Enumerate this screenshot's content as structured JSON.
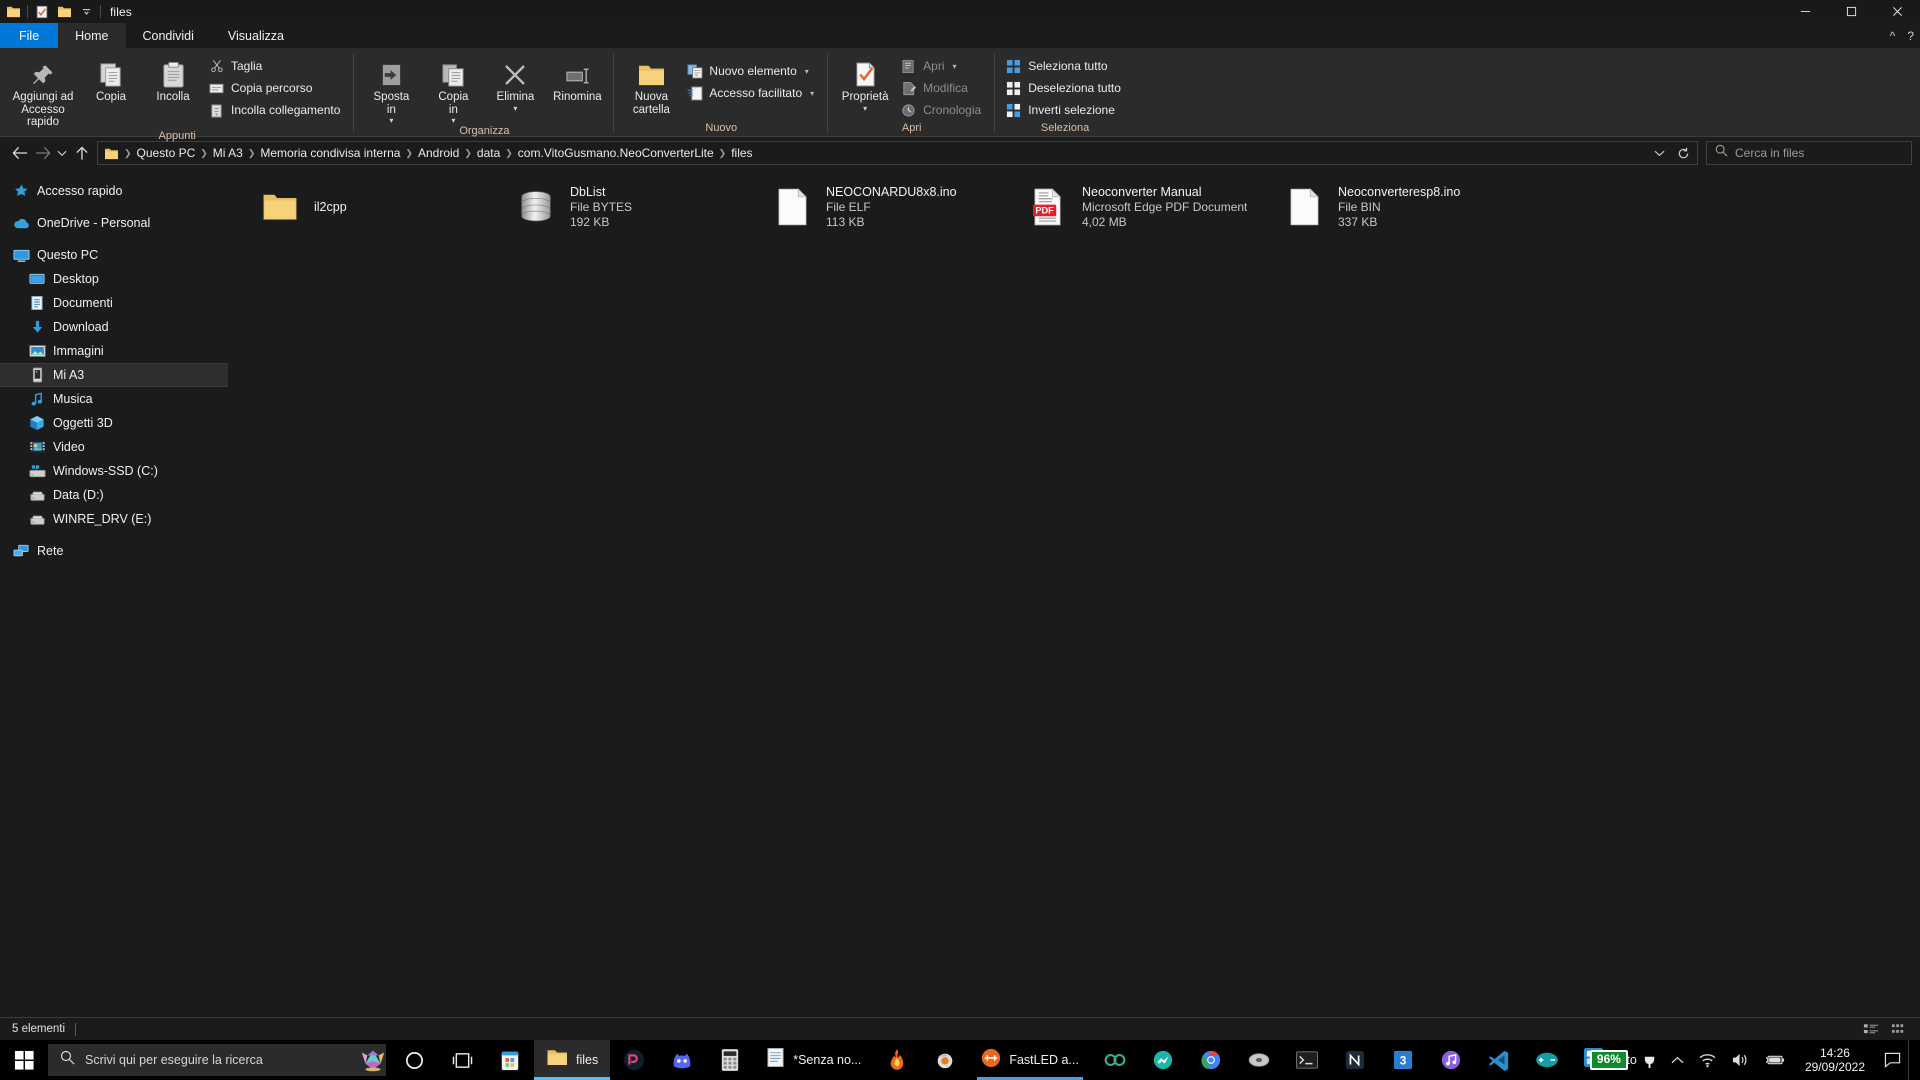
{
  "window": {
    "title": "files",
    "quick_access_icons": [
      "folder-icon",
      "properties-check-icon",
      "new-folder-icon",
      "customize-chevron-icon"
    ],
    "minimize_label": "Riduci a icona",
    "maximize_label": "Ingrandisci",
    "close_label": "Chiudi"
  },
  "tabs": [
    {
      "label": "File",
      "type": "file"
    },
    {
      "label": "Home",
      "type": "active"
    },
    {
      "label": "Condividi",
      "type": "normal"
    },
    {
      "label": "Visualizza",
      "type": "normal"
    }
  ],
  "tab_right": {
    "collapse": "chevron-up-icon",
    "help": "help-icon"
  },
  "ribbon": {
    "groups": [
      {
        "label": "Appunti",
        "big": [
          {
            "label": "Aggiungi ad\nAccesso rapido",
            "icon": "pin-icon",
            "wide": true
          },
          {
            "label": "Copia",
            "icon": "copy-icon"
          },
          {
            "label": "Incolla",
            "icon": "paste-icon"
          }
        ],
        "small": [
          {
            "label": "Taglia",
            "icon": "scissors-icon",
            "dim": false
          },
          {
            "label": "Copia percorso",
            "icon": "copy-path-icon",
            "dim": false
          },
          {
            "label": "Incolla collegamento",
            "icon": "paste-shortcut-icon",
            "dim": false
          }
        ]
      },
      {
        "label": "Organizza",
        "big": [
          {
            "label": "Sposta\nin",
            "icon": "move-to-icon",
            "caret": true
          },
          {
            "label": "Copia\nin",
            "icon": "copy-to-icon",
            "caret": true
          },
          {
            "label": "Elimina",
            "icon": "delete-icon",
            "caret": true
          },
          {
            "label": "Rinomina",
            "icon": "rename-icon"
          }
        ],
        "small": []
      },
      {
        "label": "Nuovo",
        "big": [
          {
            "label": "Nuova\ncartella",
            "icon": "new-folder-icon"
          }
        ],
        "small": [
          {
            "label": "Nuovo elemento",
            "icon": "new-item-icon",
            "caret": true
          },
          {
            "label": "Accesso facilitato",
            "icon": "easy-access-icon",
            "caret": true
          }
        ]
      },
      {
        "label": "Apri",
        "big": [
          {
            "label": "Proprietà",
            "icon": "properties-icon",
            "caret": true
          }
        ],
        "small": [
          {
            "label": "Apri",
            "icon": "open-icon",
            "dim": true,
            "caret": true
          },
          {
            "label": "Modifica",
            "icon": "edit-icon",
            "dim": true
          },
          {
            "label": "Cronologia",
            "icon": "history-icon",
            "dim": true
          }
        ]
      },
      {
        "label": "Seleziona",
        "big": [],
        "small": [
          {
            "label": "Seleziona tutto",
            "icon": "select-all-icon"
          },
          {
            "label": "Deseleziona tutto",
            "icon": "select-none-icon"
          },
          {
            "label": "Inverti selezione",
            "icon": "invert-selection-icon"
          }
        ]
      }
    ]
  },
  "navigation": {
    "back_label": "Indietro",
    "forward_label": "Avanti",
    "recent_label": "Percorsi recenti",
    "up_label": "Livello superiore",
    "breadcrumb": [
      "Questo PC",
      "Mi A3",
      "Memoria condivisa interna",
      "Android",
      "data",
      "com.VitoGusmano.NeoConverterLite",
      "files"
    ],
    "refresh_label": "Aggiorna",
    "dropdown_label": "Percorsi precedenti"
  },
  "search": {
    "placeholder": "Cerca in files",
    "icon": "search-icon"
  },
  "sidebar": {
    "items": [
      {
        "label": "Accesso rapido",
        "icon": "star-pin-icon",
        "level": 0,
        "selected": false
      },
      {
        "label": "OneDrive - Personal",
        "icon": "cloud-icon",
        "level": 0,
        "selected": false,
        "gap_before": true
      },
      {
        "label": "Questo PC",
        "icon": "monitor-icon",
        "level": 0,
        "selected": false,
        "gap_before": true
      },
      {
        "label": "Desktop",
        "icon": "desktop-icon",
        "level": 1,
        "selected": false
      },
      {
        "label": "Documenti",
        "icon": "documents-icon",
        "level": 1,
        "selected": false
      },
      {
        "label": "Download",
        "icon": "download-icon",
        "level": 1,
        "selected": false
      },
      {
        "label": "Immagini",
        "icon": "pictures-icon",
        "level": 1,
        "selected": false
      },
      {
        "label": "Mi A3",
        "icon": "phone-icon",
        "level": 1,
        "selected": true
      },
      {
        "label": "Musica",
        "icon": "music-icon",
        "level": 1,
        "selected": false
      },
      {
        "label": "Oggetti 3D",
        "icon": "3d-objects-icon",
        "level": 1,
        "selected": false
      },
      {
        "label": "Video",
        "icon": "video-icon",
        "level": 1,
        "selected": false
      },
      {
        "label": "Windows-SSD (C:)",
        "icon": "system-drive-icon",
        "level": 1,
        "selected": false
      },
      {
        "label": "Data (D:)",
        "icon": "drive-icon",
        "level": 1,
        "selected": false
      },
      {
        "label": "WINRE_DRV (E:)",
        "icon": "drive-icon",
        "level": 1,
        "selected": false
      },
      {
        "label": "Rete",
        "icon": "network-icon",
        "level": 0,
        "selected": false,
        "gap_before": true
      }
    ]
  },
  "files": [
    {
      "name": "il2cpp",
      "type": "",
      "size": "",
      "icon": "folder-icon"
    },
    {
      "name": "DbList",
      "type": "File BYTES",
      "size": "192 KB",
      "icon": "database-icon"
    },
    {
      "name": "NEOCONARDU8x8.ino",
      "type": "File ELF",
      "size": "113 KB",
      "icon": "blank-file-icon"
    },
    {
      "name": "Neoconverter Manual",
      "type": "Microsoft Edge PDF Document",
      "size": "4,02 MB",
      "icon": "pdf-icon"
    },
    {
      "name": "Neoconverteresp8.ino",
      "type": "File BIN",
      "size": "337 KB",
      "icon": "blank-file-icon"
    }
  ],
  "statusbar": {
    "count": "5 elementi",
    "view_details": "details-view-icon",
    "view_large": "large-icons-view-icon"
  },
  "taskbar": {
    "start_label": "Start",
    "search_placeholder": "Scrivi qui per eseguire la ricerca",
    "items": [
      {
        "name": "cortana-icon",
        "label": "",
        "state": "normal"
      },
      {
        "name": "task-view-icon",
        "label": "",
        "state": "normal"
      },
      {
        "name": "microsoft-store-icon",
        "label": "",
        "state": "normal"
      },
      {
        "name": "file-explorer-task",
        "label": "files",
        "state": "active"
      },
      {
        "name": "photoshop-icon",
        "label": "",
        "state": "normal"
      },
      {
        "name": "discord-icon",
        "label": "",
        "state": "normal"
      },
      {
        "name": "calculator-icon",
        "label": "",
        "state": "normal"
      },
      {
        "name": "notepad-task",
        "label": "*Senza no...",
        "state": "normal"
      },
      {
        "name": "flame-icon",
        "label": "",
        "state": "normal"
      },
      {
        "name": "blender-icon",
        "label": "",
        "state": "normal"
      },
      {
        "name": "fastled-task",
        "label": "FastLED a...",
        "state": "underline"
      },
      {
        "name": "link-icon",
        "label": "",
        "state": "normal"
      },
      {
        "name": "messenger-icon",
        "label": "",
        "state": "normal"
      },
      {
        "name": "chrome-icon",
        "label": "",
        "state": "normal"
      },
      {
        "name": "disk-icon",
        "label": "",
        "state": "normal"
      },
      {
        "name": "terminal-icon",
        "label": "",
        "state": "normal"
      },
      {
        "name": "notion-icon",
        "label": "",
        "state": "normal"
      },
      {
        "name": "office-icon",
        "label": "",
        "state": "normal"
      },
      {
        "name": "music-app-icon",
        "label": "",
        "state": "normal"
      },
      {
        "name": "vscode-icon",
        "label": "",
        "state": "normal"
      },
      {
        "name": "arduino-icon",
        "label": "",
        "state": "normal"
      },
      {
        "name": "photos-task",
        "label": "Foto",
        "state": "normal"
      }
    ],
    "tray": {
      "battery_percent": "96%",
      "power_icon": "power-plug-icon",
      "overflow_icon": "chevron-up-icon",
      "wifi_icon": "wifi-icon",
      "volume_icon": "speaker-icon",
      "battery_icon": "battery-icon",
      "time": "14:26",
      "date": "29/09/2022",
      "action_center_icon": "notification-icon"
    }
  },
  "colors": {
    "accent": "#0078d7",
    "ribbon_bg": "#2b2b2b",
    "window_bg": "#1b1b1b",
    "group_label": "#d8c0a8",
    "battery_green": "#0f8a2e",
    "taskbar_highlight": "#4cc2ff"
  }
}
